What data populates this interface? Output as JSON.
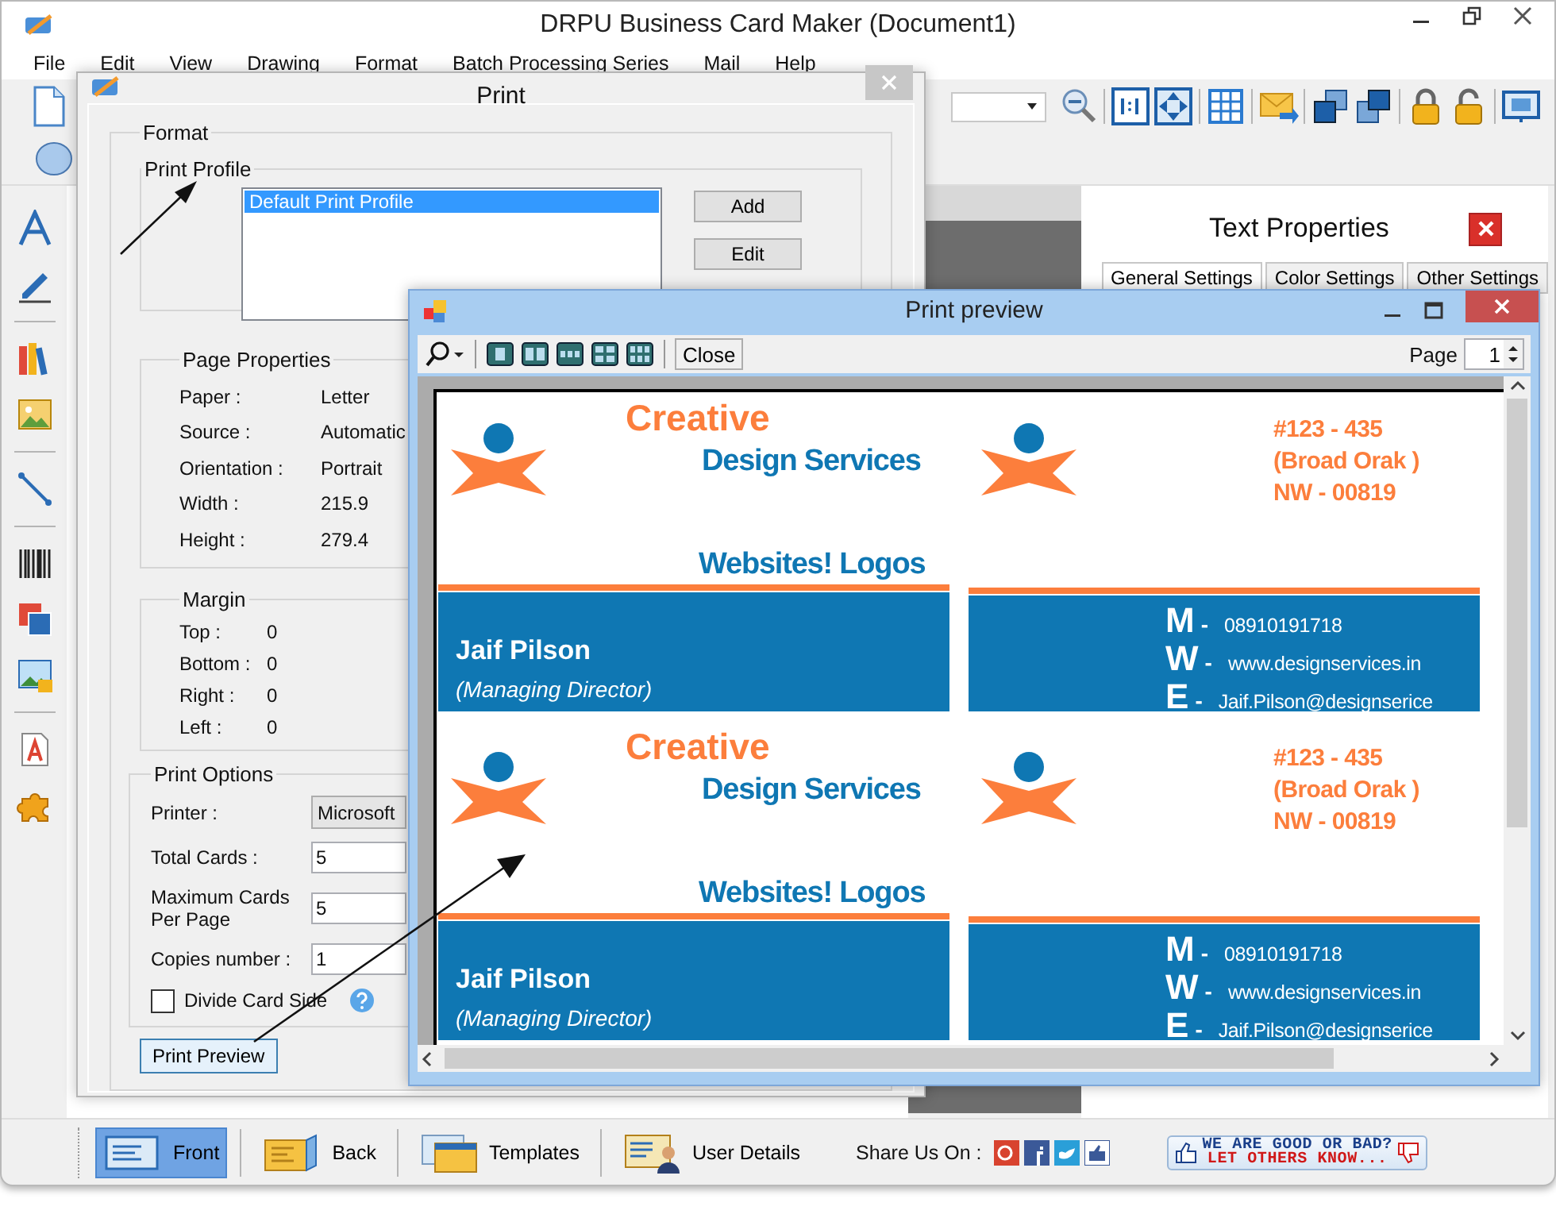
{
  "window": {
    "title": "DRPU Business Card Maker (Document1)"
  },
  "menu": [
    {
      "label": "File"
    },
    {
      "label": "Edit"
    },
    {
      "label": "View"
    },
    {
      "label": "Drawing"
    },
    {
      "label": "Format"
    },
    {
      "label": "Batch Processing Series"
    },
    {
      "label": "Mail"
    },
    {
      "label": "Help"
    }
  ],
  "text_properties": {
    "title": "Text Properties",
    "tabs": [
      {
        "label": "General Settings",
        "selected": true
      },
      {
        "label": "Color Settings",
        "selected": false
      },
      {
        "label": "Other Settings",
        "selected": false
      }
    ]
  },
  "bottom_tabs": [
    {
      "label": "Front",
      "selected": true
    },
    {
      "label": "Back",
      "selected": false
    },
    {
      "label": "Templates",
      "selected": false
    },
    {
      "label": "User Details",
      "selected": false
    }
  ],
  "share": {
    "label": "Share Us On :"
  },
  "feedback": {
    "line_1": "WE ARE GOOD OR BAD?",
    "line_2": "LET OTHERS KNOW..."
  },
  "print_dialog": {
    "title": "Print",
    "format_label": "Format",
    "print_profile": {
      "label": "Print Profile",
      "profiles": [
        {
          "label": "Default Print Profile",
          "selected": true
        }
      ],
      "buttons": [
        "Add",
        "Edit"
      ]
    },
    "page_properties": {
      "label": "Page Properties",
      "rows": [
        {
          "label": "Paper :",
          "value": "Letter"
        },
        {
          "label": "Source :",
          "value": "Automatic"
        },
        {
          "label": "Orientation :",
          "value": "Portrait"
        },
        {
          "label": "Width :",
          "value": "215.9"
        },
        {
          "label": "Height :",
          "value": "279.4"
        }
      ]
    },
    "margin": {
      "label": "Margin",
      "rows": [
        {
          "label": "Top :",
          "value": "0"
        },
        {
          "label": "Bottom :",
          "value": "0"
        },
        {
          "label": "Right :",
          "value": "0"
        },
        {
          "label": "Left :",
          "value": "0"
        }
      ]
    },
    "print_options": {
      "label": "Print Options",
      "printer": {
        "label": "Printer :",
        "value": "Microsoft"
      },
      "fields": [
        {
          "label": "Total Cards :",
          "value": "5"
        },
        {
          "label": "Maximum Cards Per Page",
          "value": "5"
        },
        {
          "label": "Copies number :",
          "value": "1"
        }
      ],
      "divide_card_side": {
        "label": "Divide Card Side",
        "checked": false
      }
    },
    "preview_button": "Print Preview"
  },
  "print_preview": {
    "title": "Print preview",
    "close_button": "Close",
    "page_label": "Page",
    "page_value": "1",
    "cards": [
      {
        "kind": "front",
        "company_1": "Creative",
        "company_2": "Design Services",
        "tagline": "Websites! Logos",
        "name": "Jaif Pilson",
        "role": "(Managing Director)"
      },
      {
        "kind": "back",
        "address": [
          "#123 - 435",
          "(Broad Orak )",
          "NW - 00819"
        ],
        "contacts": [
          {
            "letter": "M",
            "separator": "-",
            "value": "08910191718"
          },
          {
            "letter": "W",
            "separator": "-",
            "value": "www.designservices.in"
          },
          {
            "letter": "E",
            "separator": "-",
            "value": "Jaif.Pilson@designserice"
          }
        ]
      },
      {
        "kind": "front",
        "company_1": "Creative",
        "company_2": "Design Services",
        "tagline": "Websites! Logos",
        "name": "Jaif Pilson",
        "role": "(Managing Director)"
      },
      {
        "kind": "back",
        "address": [
          "#123 - 435",
          "(Broad Orak )",
          "NW - 00819"
        ],
        "contacts": [
          {
            "letter": "M",
            "separator": "-",
            "value": "08910191718"
          },
          {
            "letter": "W",
            "separator": "-",
            "value": "www.designservices.in"
          },
          {
            "letter": "E",
            "separator": "-",
            "value": "Jaif.Pilson@designserice"
          }
        ]
      }
    ]
  }
}
